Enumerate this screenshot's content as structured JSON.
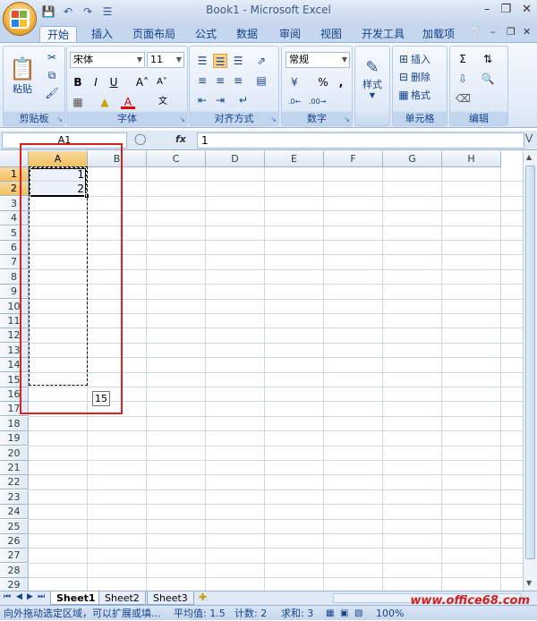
{
  "window": {
    "title": "Book1 - Microsoft Excel"
  },
  "tabs": [
    "开始",
    "插入",
    "页面布局",
    "公式",
    "数据",
    "审阅",
    "视图",
    "开发工具",
    "加载项"
  ],
  "ribbon": {
    "clipboard": {
      "label": "剪贴板",
      "paste": "粘贴"
    },
    "font": {
      "label": "字体",
      "name": "宋体",
      "size": "11"
    },
    "alignment": {
      "label": "对齐方式"
    },
    "number": {
      "label": "数字",
      "format": "常规",
      "percent": "%",
      "comma": ","
    },
    "styles": {
      "label": "样式"
    },
    "cells": {
      "label": "单元格",
      "insert": "插入",
      "delete": "删除",
      "format": "格式"
    },
    "editing": {
      "label": "编辑"
    }
  },
  "formula_bar": {
    "name_box": "A1",
    "fx": "fx",
    "value": "1"
  },
  "grid": {
    "columns": [
      "A",
      "B",
      "C",
      "D",
      "E",
      "F",
      "G",
      "H"
    ],
    "rows": [
      "1",
      "2",
      "3",
      "4",
      "5",
      "6",
      "7",
      "8",
      "9",
      "10",
      "11",
      "12",
      "13",
      "14",
      "15",
      "16",
      "17",
      "18",
      "19",
      "20",
      "21",
      "22",
      "23",
      "24",
      "25",
      "26",
      "27",
      "28",
      "29"
    ],
    "cells": {
      "A1": "1",
      "A2": "2"
    },
    "fill_badge": "15"
  },
  "sheets": [
    "Sheet1",
    "Sheet2",
    "Sheet3"
  ],
  "status": {
    "hint": "向外拖动选定区域，可以扩展或填...",
    "average": "平均值: 1.5",
    "count": "计数: 2",
    "sum": "求和: 3",
    "zoom": "100%"
  },
  "watermark": "www.office68.com"
}
